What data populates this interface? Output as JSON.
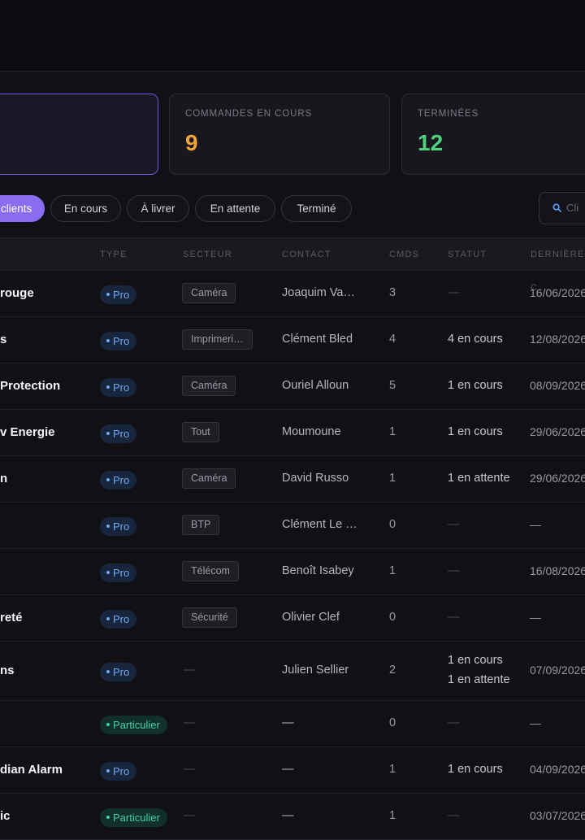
{
  "stats": {
    "active_card": {
      "label": "",
      "value": ""
    },
    "in_progress": {
      "label": "COMMANDES EN COURS",
      "value": "9",
      "color": "#f2a43a"
    },
    "done": {
      "label": "TERMINÉES",
      "value": "12",
      "color": "#4fd07e"
    }
  },
  "filters": {
    "active": "clients",
    "chips": [
      "En cours",
      "À livrer",
      "En attente",
      "Terminé"
    ]
  },
  "search": {
    "placeholder": "Cli",
    "icon": "search-icon"
  },
  "table": {
    "headers": [
      "TYPE",
      "SECTEUR",
      "CONTACT",
      "CMDS",
      "STATUT",
      "DERNIÈRE C"
    ],
    "rows": [
      {
        "name": "rouge",
        "type": "Pro",
        "sector": "Caméra",
        "contact": "Joaquim Va…",
        "cmds": "3",
        "status": [
          {
            "text": "—",
            "tone": "muted"
          }
        ],
        "date": "16/06/2026"
      },
      {
        "name": "s",
        "type": "Pro",
        "sector": "Imprimeri…",
        "contact": "Clément Bled",
        "cmds": "4",
        "status": [
          {
            "text": "4 en cours",
            "tone": "orange"
          }
        ],
        "date": "12/08/2026"
      },
      {
        "name": "Protection",
        "type": "Pro",
        "sector": "Caméra",
        "contact": "Ouriel Alloun",
        "cmds": "5",
        "status": [
          {
            "text": "1 en cours",
            "tone": "orange"
          }
        ],
        "date": "08/09/2026"
      },
      {
        "name": "v Energie",
        "type": "Pro",
        "sector": "Tout",
        "contact": "Moumoune",
        "cmds": "1",
        "status": [
          {
            "text": "1 en cours",
            "tone": "orange"
          }
        ],
        "date": "29/06/2026"
      },
      {
        "name": "n",
        "type": "Pro",
        "sector": "Caméra",
        "contact": "David Russo",
        "cmds": "1",
        "status": [
          {
            "text": "1 en attente",
            "tone": "blue"
          }
        ],
        "date": "29/06/2026"
      },
      {
        "name": "",
        "type": "Pro",
        "sector": "BTP",
        "contact": "Clément Le …",
        "cmds": "0",
        "status": [
          {
            "text": "—",
            "tone": "muted"
          }
        ],
        "date": "—"
      },
      {
        "name": "",
        "type": "Pro",
        "sector": "Télécom",
        "contact": "Benoît Isabey",
        "cmds": "1",
        "status": [
          {
            "text": "—",
            "tone": "muted"
          }
        ],
        "date": "16/08/2026"
      },
      {
        "name": "reté",
        "type": "Pro",
        "sector": "Sécurité",
        "contact": "Olivier Clef",
        "cmds": "0",
        "status": [
          {
            "text": "—",
            "tone": "muted"
          }
        ],
        "date": "—"
      },
      {
        "name": "ns",
        "type": "Pro",
        "sector": "—",
        "contact": "Julien Sellier",
        "cmds": "2",
        "status": [
          {
            "text": "1 en cours",
            "tone": "orange"
          },
          {
            "text": "1 en attente",
            "tone": "blue"
          }
        ],
        "date": "07/09/2026"
      },
      {
        "name": "",
        "type": "Particulier",
        "sector": "—",
        "contact": "—",
        "cmds": "0",
        "status": [
          {
            "text": "—",
            "tone": "muted"
          }
        ],
        "date": "—"
      },
      {
        "name": "dian Alarm",
        "type": "Pro",
        "sector": "—",
        "contact": "—",
        "cmds": "1",
        "status": [
          {
            "text": "1 en cours",
            "tone": "orange"
          }
        ],
        "date": "04/09/2026"
      },
      {
        "name": "ic",
        "type": "Particulier",
        "sector": "—",
        "contact": "—",
        "cmds": "1",
        "status": [
          {
            "text": "—",
            "tone": "muted"
          }
        ],
        "date": "03/07/2026"
      }
    ]
  }
}
